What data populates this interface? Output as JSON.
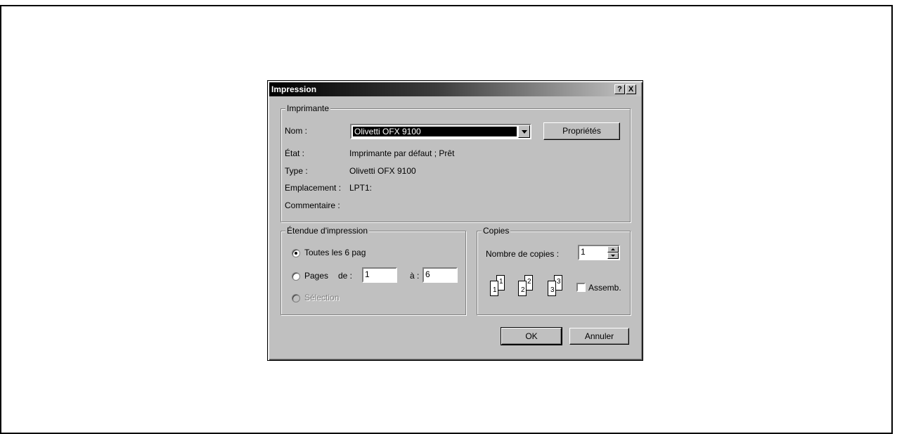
{
  "dialog": {
    "title": "Impression",
    "help_label": "?",
    "close_label": "X"
  },
  "printer": {
    "group_label": "Imprimante",
    "name_label": "Nom :",
    "name_value": "Olivetti OFX 9100",
    "properties_label": "Propriétés",
    "state_label": "État :",
    "state_value": "Imprimante par défaut ; Prêt",
    "type_label": "Type :",
    "type_value": "Olivetti OFX 9100",
    "location_label": "Emplacement :",
    "location_value": "LPT1:",
    "comment_label": "Commentaire :"
  },
  "range": {
    "group_label": "Étendue d'impression",
    "all_label": "Toutes les 6 pag",
    "pages_label": "Pages",
    "from_label": "de :",
    "from_value": "1",
    "to_label": "à :",
    "to_value": "6",
    "selection_label": "Sélection"
  },
  "copies": {
    "group_label": "Copies",
    "count_label": "Nombre de copies :",
    "count_value": "1",
    "collate_label": "Assemb.",
    "page_digits": [
      "1",
      "1",
      "2",
      "2",
      "3",
      "3"
    ]
  },
  "buttons": {
    "ok_label": "OK",
    "cancel_label": "Annuler"
  }
}
